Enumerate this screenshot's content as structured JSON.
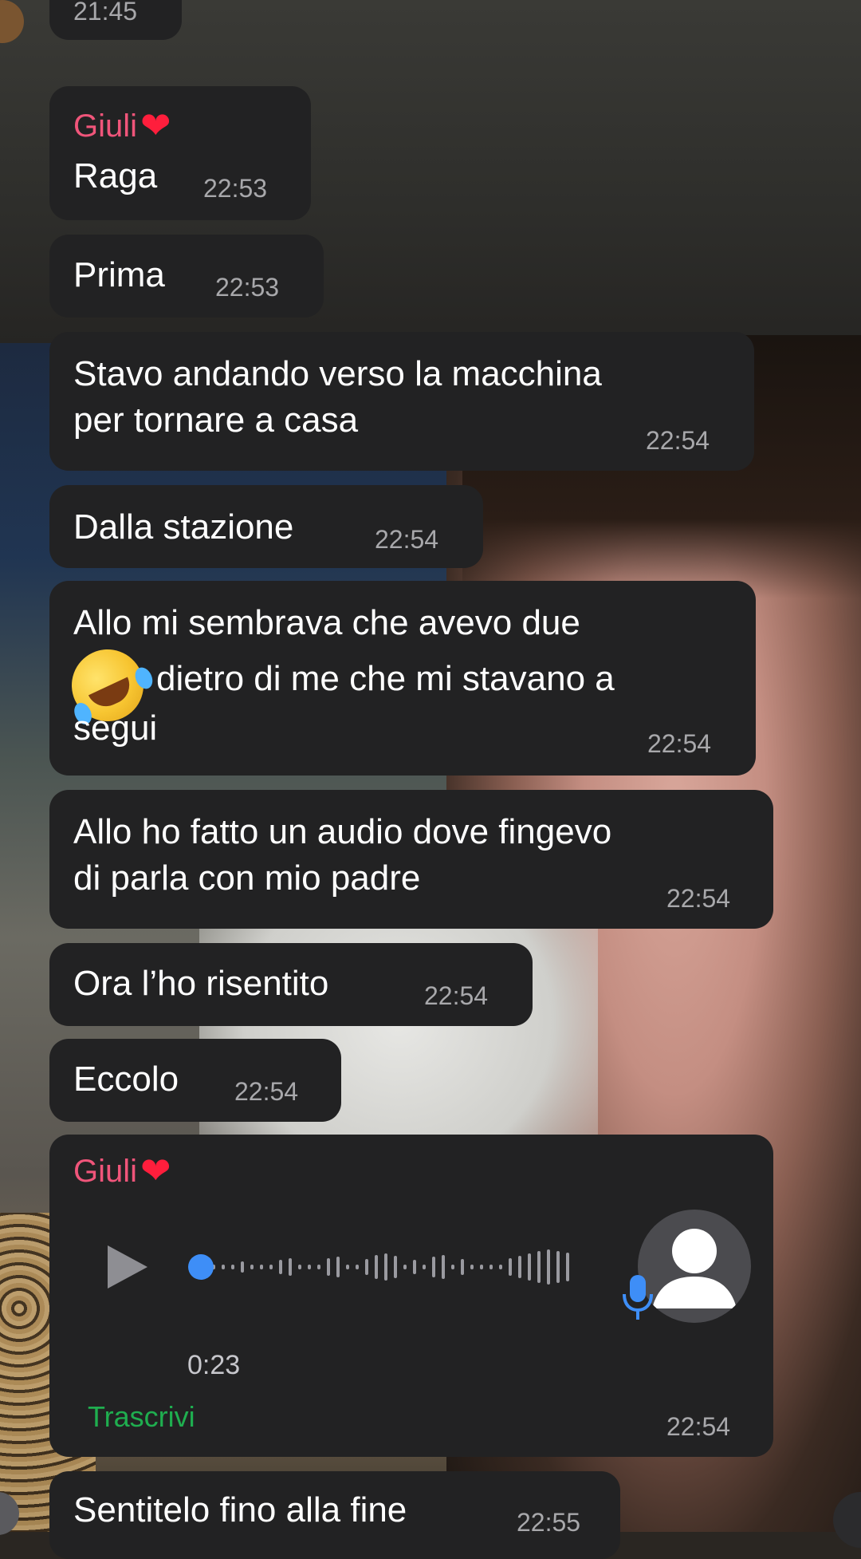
{
  "messages": [
    {
      "text": "",
      "time": "21:45"
    },
    {
      "sender": "Giuli",
      "text": "Raga",
      "time": "22:53"
    },
    {
      "text": "Prima",
      "time": "22:53"
    },
    {
      "line1": "Stavo andando verso la macchina",
      "line2": "per tornare a casa",
      "time": "22:54"
    },
    {
      "text": "Dalla stazione",
      "time": "22:54"
    },
    {
      "line1": "Allo mi sembrava che avevo due",
      "line2_after_emoji": "dietro di me che mi stavano a",
      "line3": "segui",
      "emoji": "rolling-on-floor-laughing",
      "time": "22:54"
    },
    {
      "line1": "Allo ho fatto un audio dove fingevo",
      "line2": "di parla con mio padre",
      "time": "22:54"
    },
    {
      "text": "Ora l’ho risentito",
      "time": "22:54"
    },
    {
      "text": "Eccolo",
      "time": "22:54"
    },
    {
      "text": "Sentitelo fino alla fine",
      "time": "22:55"
    }
  ],
  "voice_message": {
    "sender": "Giuli",
    "duration": "0:23",
    "transcribe_label": "Trascrivi",
    "time": "22:54",
    "progress": 0
  },
  "colors": {
    "bubble": "#222223",
    "sender": "#f0557a",
    "time": "#a8a8ab",
    "transcribe": "#1fae4f",
    "waveform_dot": "#3e8ef7"
  }
}
